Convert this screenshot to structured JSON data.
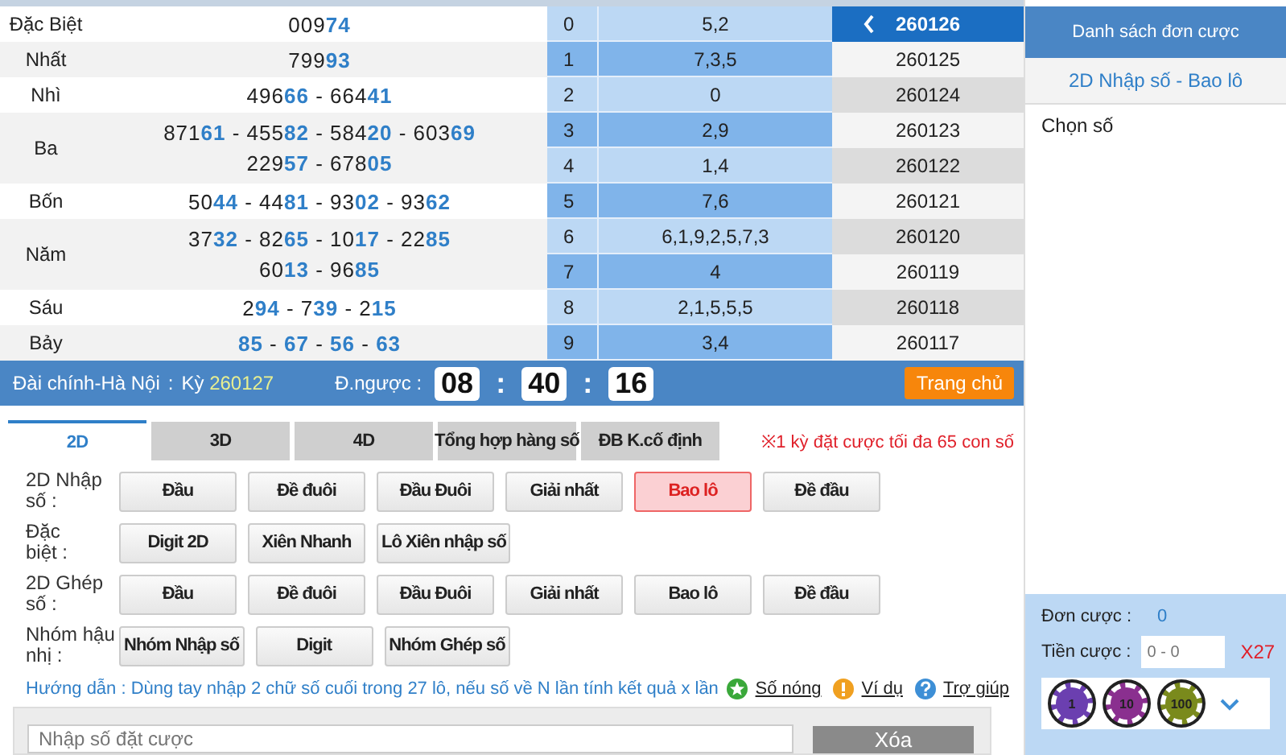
{
  "results": {
    "separator": "-",
    "prizes": [
      {
        "label": "Đặc Biệt",
        "lines": [
          [
            {
              "head": "009",
              "tail": "74"
            }
          ]
        ]
      },
      {
        "label": "Nhất",
        "lines": [
          [
            {
              "head": "799",
              "tail": "93"
            }
          ]
        ]
      },
      {
        "label": "Nhì",
        "lines": [
          [
            {
              "head": "496",
              "tail": "66"
            },
            {
              "head": "664",
              "tail": "41"
            }
          ]
        ]
      },
      {
        "label": "Ba",
        "lines": [
          [
            {
              "head": "871",
              "tail": "61"
            },
            {
              "head": "455",
              "tail": "82"
            },
            {
              "head": "584",
              "tail": "20"
            },
            {
              "head": "603",
              "tail": "69"
            }
          ],
          [
            {
              "head": "229",
              "tail": "57"
            },
            {
              "head": "678",
              "tail": "05"
            }
          ]
        ]
      },
      {
        "label": "Bốn",
        "lines": [
          [
            {
              "head": "50",
              "tail": "44"
            },
            {
              "head": "44",
              "tail": "81"
            },
            {
              "head": "93",
              "tail": "02"
            },
            {
              "head": "93",
              "tail": "62"
            }
          ]
        ]
      },
      {
        "label": "Năm",
        "lines": [
          [
            {
              "head": "37",
              "tail": "32"
            },
            {
              "head": "82",
              "tail": "65"
            },
            {
              "head": "10",
              "tail": "17"
            },
            {
              "head": "22",
              "tail": "85"
            }
          ],
          [
            {
              "head": "60",
              "tail": "13"
            },
            {
              "head": "96",
              "tail": "85"
            }
          ]
        ]
      },
      {
        "label": "Sáu",
        "lines": [
          [
            {
              "head": "2",
              "tail": "94"
            },
            {
              "head": "7",
              "tail": "39"
            },
            {
              "head": "2",
              "tail": "15"
            }
          ]
        ]
      },
      {
        "label": "Bảy",
        "lines": [
          [
            {
              "tail": "85"
            },
            {
              "tail": "67"
            },
            {
              "tail": "56"
            },
            {
              "tail": "63"
            }
          ]
        ]
      }
    ]
  },
  "digits": [
    {
      "digit": "0",
      "values": "5,2"
    },
    {
      "digit": "1",
      "values": "7,3,5"
    },
    {
      "digit": "2",
      "values": "0"
    },
    {
      "digit": "3",
      "values": "2,9"
    },
    {
      "digit": "4",
      "values": "1,4"
    },
    {
      "digit": "5",
      "values": "7,6"
    },
    {
      "digit": "6",
      "values": "6,1,9,2,5,7,3"
    },
    {
      "digit": "7",
      "values": "4"
    },
    {
      "digit": "8",
      "values": "2,1,5,5,5"
    },
    {
      "digit": "9",
      "values": "3,4"
    }
  ],
  "periods": [
    {
      "label": "260126",
      "selected": true
    },
    {
      "label": "260125",
      "selected": false
    },
    {
      "label": "260124",
      "selected": false
    },
    {
      "label": "260123",
      "selected": false
    },
    {
      "label": "260122",
      "selected": false
    },
    {
      "label": "260121",
      "selected": false
    },
    {
      "label": "260120",
      "selected": false
    },
    {
      "label": "260119",
      "selected": false
    },
    {
      "label": "260118",
      "selected": false
    },
    {
      "label": "260117",
      "selected": false
    }
  ],
  "info_bar": {
    "station": "Đài chính-Hà Nội",
    "colon": ":",
    "period_label": "Kỳ",
    "period": "260127",
    "countdown_label": "Đ.ngược :",
    "timer": [
      "08",
      "40",
      "16"
    ],
    "timer_separator": ":",
    "home_button": "Trang chủ"
  },
  "tabs": [
    {
      "label": "2D",
      "selected": true
    },
    {
      "label": "3D",
      "selected": false
    },
    {
      "label": "4D",
      "selected": false
    },
    {
      "label": "Tổng hợp hàng số",
      "selected": false
    },
    {
      "label": "ĐB K.cố định",
      "selected": false
    }
  ],
  "notice": "※1 kỳ đặt cược tối đa 65 con số",
  "bet_groups": [
    {
      "label": "2D Nhập\nsố :",
      "buttons": [
        {
          "label": "Đầu",
          "selected": false
        },
        {
          "label": "Đề đuôi",
          "selected": false
        },
        {
          "label": "Đầu Đuôi",
          "selected": false
        },
        {
          "label": "Giải nhất",
          "selected": false
        },
        {
          "label": "Bao lô",
          "selected": true
        },
        {
          "label": "Đề đầu",
          "selected": false
        }
      ]
    },
    {
      "label": "Đặc\nbiệt :",
      "buttons": [
        {
          "label": "Digit 2D",
          "selected": false
        },
        {
          "label": "Xiên Nhanh",
          "selected": false
        },
        {
          "label": "Lô Xiên nhập số",
          "selected": false
        }
      ]
    },
    {
      "label": "2D Ghép\nsố :",
      "buttons": [
        {
          "label": "Đầu",
          "selected": false
        },
        {
          "label": "Đề đuôi",
          "selected": false
        },
        {
          "label": "Đầu Đuôi",
          "selected": false
        },
        {
          "label": "Giải nhất",
          "selected": false
        },
        {
          "label": "Bao lô",
          "selected": false
        },
        {
          "label": "Đề đầu",
          "selected": false
        }
      ]
    },
    {
      "label": "Nhóm hậu\nnhị :",
      "buttons": [
        {
          "label": "Nhóm Nhập số",
          "selected": false
        },
        {
          "label": "Digit",
          "selected": false
        },
        {
          "label": "Nhóm Ghép số",
          "selected": false
        }
      ]
    }
  ],
  "guide": "Hướng dẫn : Dùng tay nhập 2 chữ số cuối trong 27 lô, nếu số về N lần tính kết quả x lần",
  "help_links": [
    {
      "kind": "hot",
      "label": "Số nóng"
    },
    {
      "kind": "example",
      "label": "Ví dụ"
    },
    {
      "kind": "help",
      "label": "Trợ giúp"
    }
  ],
  "entry": {
    "placeholder": "Nhập số đặt cược",
    "clear_button": "Xóa"
  },
  "bet_panel": {
    "title": "Danh sách đơn cược",
    "subtitle": "2D Nhập số - Bao lô",
    "pick_label": "Chọn số",
    "orders_label": "Đơn cược :",
    "orders": "0",
    "amount_label": "Tiền cược :",
    "amount_placeholder": "0 - 0",
    "multiplier": "X27",
    "chips": [
      {
        "label": "1",
        "color": "#6b3fb0"
      },
      {
        "label": "10",
        "color": "#8a2f8f"
      },
      {
        "label": "100",
        "color": "#7a8a1c"
      }
    ]
  }
}
